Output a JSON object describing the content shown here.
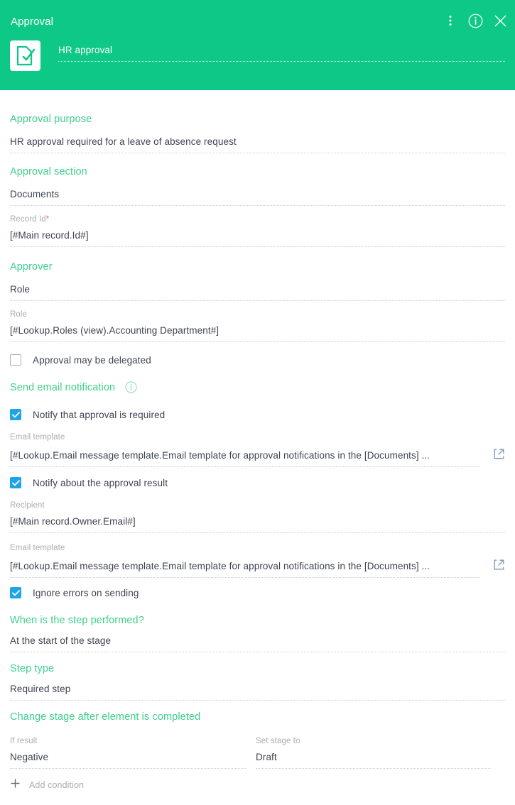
{
  "colors": {
    "header_green": "#0ec887",
    "section_green": "#3ecf8e",
    "checkbox_blue": "#1ea5e8",
    "required_red": "#f2634a",
    "ext_link_blue": "#7b95b5",
    "value_text": "#3d4450",
    "label_gray": "#a8adb3"
  },
  "header": {
    "title": "Approval",
    "name_value": "HR approval",
    "icons": {
      "menu": "kebab-menu-icon",
      "info": "info-circle-icon",
      "close": "close-icon",
      "tile": "document-check-icon"
    }
  },
  "fields": {
    "approval_purpose": {
      "section": "Approval purpose",
      "value": "HR approval required for a leave of absence request"
    },
    "approval_section": {
      "section": "Approval section",
      "value": "Documents"
    },
    "record_id": {
      "label": "Record Id",
      "required": "*",
      "value": "[#Main record.Id#]"
    },
    "approver": {
      "section": "Approver",
      "value": "Role"
    },
    "role": {
      "label": "Role",
      "value": "[#Lookup.Roles (view).Accounting Department#]"
    },
    "delegate_checkbox": {
      "label": "Approval may be delegated",
      "checked": false
    },
    "send_email": {
      "section": "Send email notification"
    },
    "notify_required": {
      "label": "Notify that approval is required",
      "checked": true
    },
    "email_template_1": {
      "label": "Email template",
      "value": "[#Lookup.Email message template.Email template for approval notifications in the [Documents] ..."
    },
    "notify_result": {
      "label": "Notify about the approval result",
      "checked": true
    },
    "recipient": {
      "label": "Recipient",
      "value": "[#Main record.Owner.Email#]"
    },
    "email_template_2": {
      "label": "Email template",
      "value": "[#Lookup.Email message template.Email template for approval notifications in the [Documents] ..."
    },
    "ignore_errors": {
      "label": "Ignore errors on sending",
      "checked": true
    },
    "when_performed": {
      "section": "When is the step performed?",
      "value": "At the start of the stage"
    },
    "step_type": {
      "section": "Step type",
      "value": "Required step"
    },
    "change_stage": {
      "section": "Change stage after element is completed"
    },
    "if_result": {
      "label": "If result",
      "value": "Negative"
    },
    "set_stage_to": {
      "label": "Set stage to",
      "value": "Draft"
    },
    "add_condition": {
      "label": "Add condition"
    }
  }
}
